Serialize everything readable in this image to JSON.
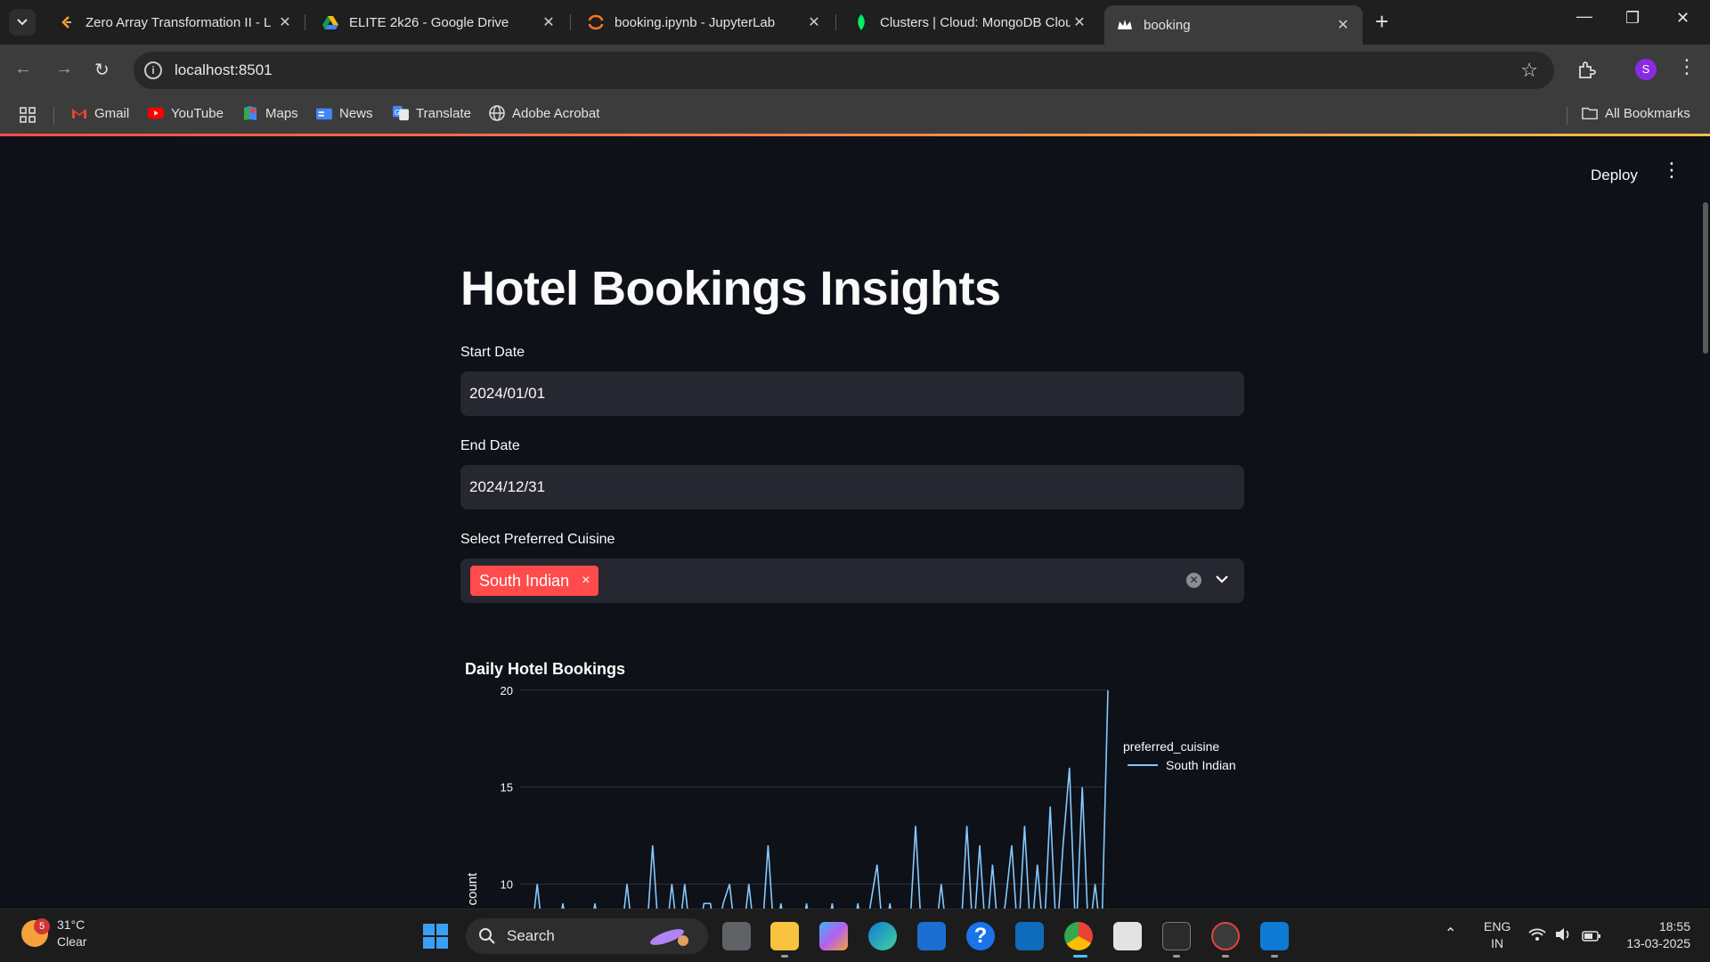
{
  "browser": {
    "tabs": [
      {
        "title": "Zero Array Transformation II - L",
        "close": "✕"
      },
      {
        "title": "ELITE 2k26 - Google Drive",
        "close": "✕"
      },
      {
        "title": "booking.ipynb - JupyterLab",
        "close": "✕"
      },
      {
        "title": "Clusters | Cloud: MongoDB Clou",
        "close": "✕"
      },
      {
        "title": "booking",
        "close": "✕"
      }
    ],
    "url": "localhost:8501",
    "profile_initial": "S",
    "bookmarks": [
      "Gmail",
      "YouTube",
      "Maps",
      "News",
      "Translate",
      "Adobe Acrobat"
    ],
    "all_bookmarks": "All Bookmarks"
  },
  "app": {
    "deploy_label": "Deploy",
    "title": "Hotel Bookings Insights",
    "start_date_label": "Start Date",
    "start_date_value": "2024/01/01",
    "end_date_label": "End Date",
    "end_date_value": "2024/12/31",
    "cuisine_label": "Select Preferred Cuisine",
    "cuisine_selected": "South Indian",
    "chip_remove": "×"
  },
  "chart_data": {
    "type": "line",
    "title": "Daily Hotel Bookings",
    "ylabel": "count",
    "yticks": [
      10,
      15,
      20
    ],
    "ylim": [
      8.6,
      21
    ],
    "legend_title": "preferred_cuisine",
    "legend_placement": "top-right",
    "grid": true,
    "series": [
      {
        "name": "South Indian",
        "color": "#83c9ff",
        "points": [
          [
            0,
            7
          ],
          [
            1,
            10
          ],
          [
            2,
            7
          ],
          [
            4,
            7
          ],
          [
            5,
            9
          ],
          [
            6,
            7
          ],
          [
            9,
            7
          ],
          [
            10,
            9
          ],
          [
            11,
            7
          ],
          [
            14,
            7
          ],
          [
            15,
            10
          ],
          [
            16,
            7
          ],
          [
            18,
            7
          ],
          [
            19,
            12
          ],
          [
            20,
            7
          ],
          [
            21,
            7
          ],
          [
            22,
            10
          ],
          [
            23,
            7
          ],
          [
            24,
            10
          ],
          [
            25,
            7
          ],
          [
            26,
            7
          ],
          [
            27,
            9
          ],
          [
            28,
            9
          ],
          [
            29,
            7
          ],
          [
            30,
            9
          ],
          [
            31,
            10
          ],
          [
            32,
            7
          ],
          [
            33,
            7
          ],
          [
            34,
            10
          ],
          [
            35,
            7
          ],
          [
            36,
            7
          ],
          [
            37,
            12
          ],
          [
            38,
            7
          ],
          [
            39,
            9
          ],
          [
            40,
            7
          ],
          [
            42,
            7
          ],
          [
            43,
            9
          ],
          [
            44,
            7
          ],
          [
            46,
            7
          ],
          [
            47,
            9
          ],
          [
            48,
            7
          ],
          [
            50,
            7
          ],
          [
            51,
            9
          ],
          [
            52,
            7
          ],
          [
            53,
            9
          ],
          [
            54,
            11
          ],
          [
            55,
            7
          ],
          [
            56,
            9
          ],
          [
            57,
            7
          ],
          [
            59,
            7
          ],
          [
            60,
            13
          ],
          [
            61,
            7
          ],
          [
            63,
            7
          ],
          [
            64,
            10
          ],
          [
            65,
            7
          ],
          [
            67,
            7
          ],
          [
            68,
            13
          ],
          [
            69,
            7
          ],
          [
            70,
            12
          ],
          [
            71,
            7
          ],
          [
            72,
            11
          ],
          [
            73,
            7
          ],
          [
            74,
            9
          ],
          [
            75,
            12
          ],
          [
            76,
            7
          ],
          [
            77,
            13
          ],
          [
            78,
            7
          ],
          [
            79,
            11
          ],
          [
            80,
            7
          ],
          [
            81,
            14
          ],
          [
            82,
            7
          ],
          [
            83,
            12
          ],
          [
            84,
            16
          ],
          [
            85,
            7
          ],
          [
            86,
            15
          ],
          [
            87,
            7
          ],
          [
            88,
            10
          ],
          [
            89,
            7
          ],
          [
            90,
            20
          ]
        ]
      }
    ]
  },
  "taskbar": {
    "weather_badge": "5",
    "temperature": "31°C",
    "condition": "Clear",
    "search_label": "Search",
    "lang_top": "ENG",
    "lang_bottom": "IN",
    "time": "18:55",
    "date": "13-03-2025"
  }
}
